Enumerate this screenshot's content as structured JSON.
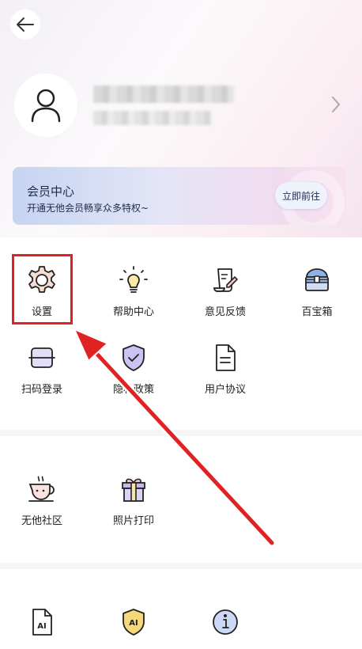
{
  "header": {
    "back_icon": "arrow-left-icon"
  },
  "profile": {
    "avatar_icon": "user-icon",
    "arrow_icon": "chevron-right-icon"
  },
  "vip": {
    "title": "会员中心",
    "desc": "开通无他会员畅享众多特权~",
    "button": "立即前往"
  },
  "tools": [
    {
      "label": "设置",
      "icon": "gear-icon"
    },
    {
      "label": "帮助中心",
      "icon": "lightbulb-icon"
    },
    {
      "label": "意见反馈",
      "icon": "feedback-scroll-icon"
    },
    {
      "label": "百宝箱",
      "icon": "treasure-chest-icon"
    },
    {
      "label": "扫码登录",
      "icon": "scan-icon"
    },
    {
      "label": "隐私政策",
      "icon": "shield-check-icon"
    },
    {
      "label": "用户协议",
      "icon": "document-icon"
    }
  ],
  "community": [
    {
      "label": "无他社区",
      "icon": "coffee-cup-icon"
    },
    {
      "label": "照片打印",
      "icon": "gift-box-icon"
    }
  ],
  "ai": [
    {
      "icon": "ai-document-icon"
    },
    {
      "icon": "ai-shield-icon"
    },
    {
      "icon": "info-icon"
    }
  ],
  "annotation": {
    "highlight_color": "#e02222"
  }
}
